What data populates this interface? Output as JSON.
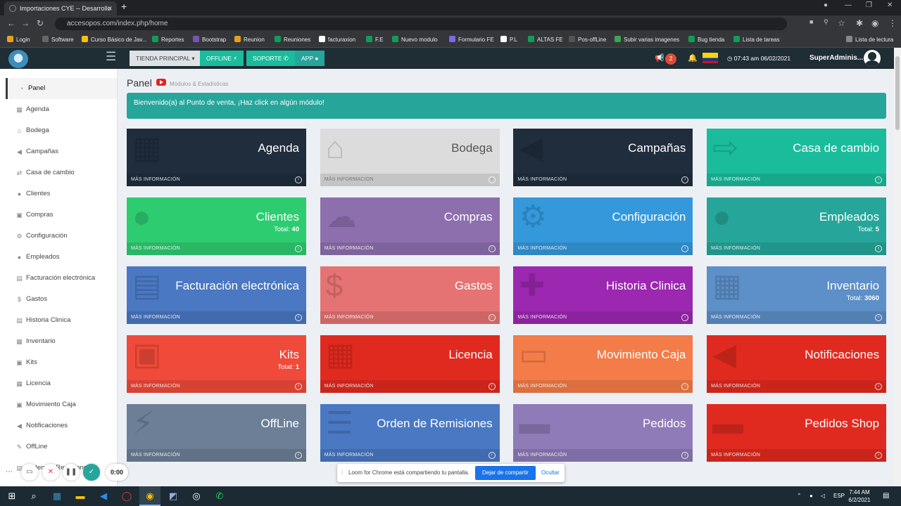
{
  "browser": {
    "tab_title": "Importaciones CYE -- Desarrollo",
    "url": "accesopos.com/index.php/home",
    "bookmarks": [
      "Login",
      "Software",
      "Curso Básico de Jav...",
      "Reportes",
      "Bootstrap",
      "Reunion",
      "Reuniones",
      "facturaxion",
      "F.E",
      "Nuevo modulo",
      "Formulario FE",
      "P.L",
      "ALTAS FE",
      "Pos-offLine",
      "Subir varias imagenes",
      "Bug tienda",
      "Lista de tareas"
    ],
    "reading_list": "Lista de lectura"
  },
  "header": {
    "tienda_principal": "TIENDA PRINCIPAL",
    "offline": "OFFLINE",
    "soporte": "SOPORTE",
    "app": "APP",
    "notif_count": "2",
    "datetime": "07:43 am 06/02/2021",
    "user": "SuperAdminis..."
  },
  "sidebar": {
    "items": [
      "Panel",
      "Agenda",
      "Bodega",
      "Campañas",
      "Casa de cambio",
      "Clientes",
      "Compras",
      "Configuración",
      "Empleados",
      "Facturación electrónica",
      "Gastos",
      "Historia Clinica",
      "Inventario",
      "Kits",
      "Licencia",
      "Movimiento Caja",
      "Notificaciones",
      "OffLine",
      "Orden de Remisiones"
    ]
  },
  "main": {
    "title": "Panel",
    "subtitle": "Módulos & Estadísticas",
    "alert": "Bienvenido(a) al Punto de venta, ¡Haz click en algún módulo!",
    "more_info": "MÁS INFORMACIÓN",
    "total_label": "Total:",
    "boxes": [
      {
        "title": "Agenda",
        "color": "#1f2d3d",
        "icon": "calendar-icon"
      },
      {
        "title": "Bodega",
        "color": "#dcdcdc",
        "icon": "bank-icon"
      },
      {
        "title": "Campañas",
        "color": "#1f2d3d",
        "icon": "bullhorn-icon"
      },
      {
        "title": "Casa de cambio",
        "color": "#1abc9c",
        "icon": "exchange-icon"
      },
      {
        "title": "Clientes",
        "color": "#2ecc71",
        "icon": "users-icon",
        "total": "40"
      },
      {
        "title": "Compras",
        "color": "#8e6fae",
        "icon": "cloud-download-icon"
      },
      {
        "title": "Configuración",
        "color": "#3498db",
        "icon": "gears-icon"
      },
      {
        "title": "Empleados",
        "color": "#26a69a",
        "icon": "user-icon",
        "total": "5"
      },
      {
        "title": "Facturación electrónica",
        "color": "#4a78c2",
        "icon": "file-icon"
      },
      {
        "title": "Gastos",
        "color": "#e57373",
        "icon": "dollar-icon"
      },
      {
        "title": "Historia Clinica",
        "color": "#9c27b0",
        "icon": "medical-icon"
      },
      {
        "title": "Inventario",
        "color": "#5d8fc8",
        "icon": "building-icon",
        "total": "3060"
      },
      {
        "title": "Kits",
        "color": "#ef4a3a",
        "icon": "box-icon",
        "total": "1"
      },
      {
        "title": "Licencia",
        "color": "#e02a1f",
        "icon": "calendar-icon"
      },
      {
        "title": "Movimiento Caja",
        "color": "#f47c48",
        "icon": "money-icon"
      },
      {
        "title": "Notificaciones",
        "color": "#e02a1f",
        "icon": "bullhorn-icon"
      },
      {
        "title": "OffLine",
        "color": "#6c7f97",
        "icon": "plug-icon"
      },
      {
        "title": "Orden de Remisiones",
        "color": "#4a78c2",
        "icon": "list-icon"
      },
      {
        "title": "Pedidos",
        "color": "#8e7bb8",
        "icon": "truck-icon"
      },
      {
        "title": "Pedidos Shop",
        "color": "#e02a1f",
        "icon": "truck-icon"
      }
    ]
  },
  "loom": {
    "timer": "0:00",
    "share_msg": "Loom for Chrome está compartiendo tu pantalla.",
    "stop_share": "Dejar de compartir",
    "hide": "Ocultar"
  },
  "taskbar": {
    "lang": "ESP",
    "time": "7:44 AM",
    "date": "6/2/2021"
  }
}
